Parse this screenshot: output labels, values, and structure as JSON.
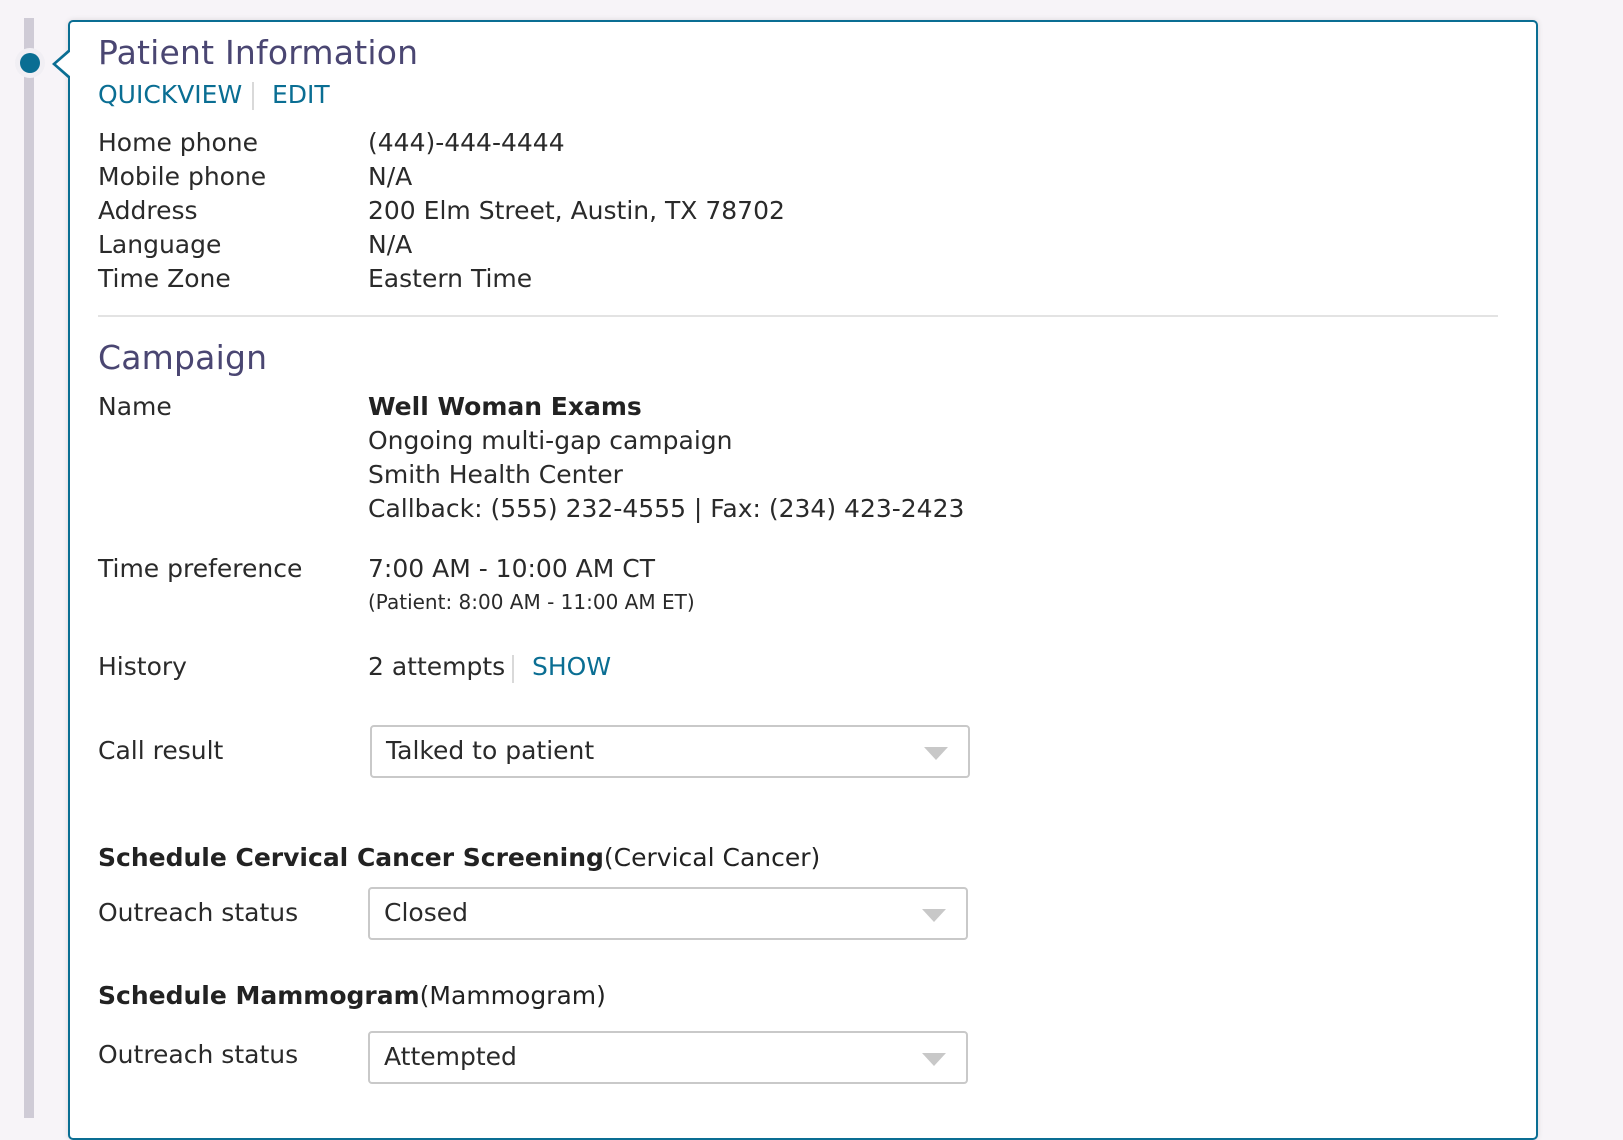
{
  "colors": {
    "accent": "#0a6e93",
    "title": "#4a4672",
    "track": "#cfcbd6"
  },
  "patient_info": {
    "title": "Patient Information",
    "actions": {
      "quickview": "QUICKVIEW",
      "edit": "EDIT"
    },
    "fields": [
      {
        "label": "Home phone",
        "value": "(444)-444-4444"
      },
      {
        "label": "Mobile phone",
        "value": "N/A"
      },
      {
        "label": "Address",
        "value": "200 Elm Street, Austin, TX 78702"
      },
      {
        "label": "Language",
        "value": "N/A"
      },
      {
        "label": "Time Zone",
        "value": "Eastern Time"
      }
    ]
  },
  "campaign": {
    "title": "Campaign",
    "name_label": "Name",
    "name": "Well Woman Exams",
    "description": "Ongoing multi-gap campaign",
    "center": "Smith Health Center",
    "contact": "Callback: (555) 232-4555 | Fax: (234) 423-2423",
    "time_pref_label": "Time preference",
    "time_pref": "7:00 AM - 10:00 AM CT",
    "time_pref_patient": "(Patient: 8:00 AM - 11:00 AM ET)",
    "history_label": "History",
    "history_value": "2 attempts",
    "history_show": "SHOW",
    "call_result_label": "Call result",
    "call_result_value": "Talked to patient"
  },
  "gaps": [
    {
      "title_bold": "Schedule Cervical Cancer Screening",
      "title_paren": "(Cervical Cancer)",
      "status_label": "Outreach status",
      "status_value": "Closed"
    },
    {
      "title_bold": "Schedule Mammogram",
      "title_paren": "(Mammogram)",
      "status_label": "Outreach status",
      "status_value": "Attempted"
    }
  ]
}
